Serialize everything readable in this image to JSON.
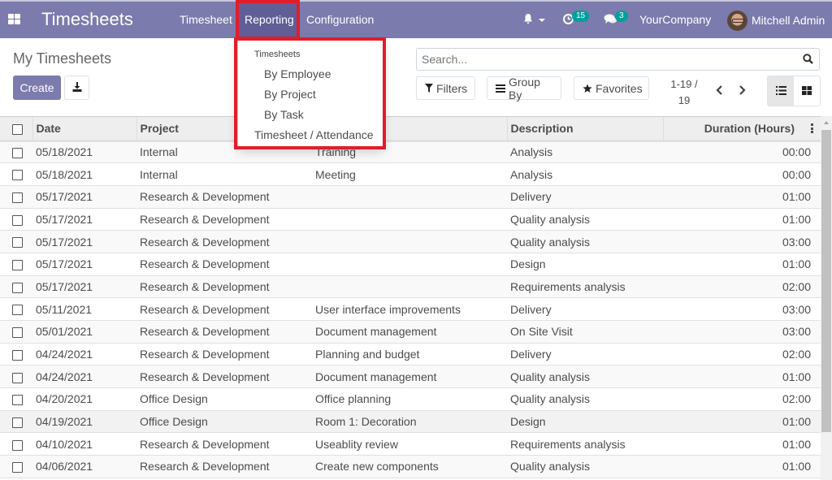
{
  "navbar": {
    "app_title": "Timesheets",
    "menu": [
      {
        "label": "Timesheet"
      },
      {
        "label": "Reporting",
        "active": true
      },
      {
        "label": "Configuration"
      }
    ],
    "activity_count": "15",
    "messages_count": "3",
    "company": "YourCompany",
    "user_name": "Mitchell Admin",
    "accent_color": "#7c7bad",
    "badge_color": "#00a09d"
  },
  "reporting_dropdown": {
    "header": "Timesheets",
    "items": [
      {
        "label": "By Employee"
      },
      {
        "label": "By Project"
      },
      {
        "label": "By Task"
      },
      {
        "label": "Timesheet / Attendance"
      }
    ],
    "highlight_color": "#e21d2a"
  },
  "control_panel": {
    "breadcrumb": "My Timesheets",
    "create_label": "Create",
    "search_placeholder": "Search...",
    "filters_label": "Filters",
    "groupby_label": "Group By",
    "favorites_label": "Favorites",
    "pager_line1": "1-19 /",
    "pager_line2": "19",
    "active_view": "list"
  },
  "table": {
    "headers": {
      "date": "Date",
      "project": "Project",
      "task": "",
      "description": "Description",
      "duration": "Duration (Hours)"
    },
    "rows": [
      {
        "date": "05/18/2021",
        "project": "Internal",
        "task": "Training",
        "description": "Analysis",
        "duration": "00:00"
      },
      {
        "date": "05/18/2021",
        "project": "Internal",
        "task": "Meeting",
        "description": "Analysis",
        "duration": "00:00"
      },
      {
        "date": "05/17/2021",
        "project": "Research & Development",
        "task": "",
        "description": "Delivery",
        "duration": "01:00"
      },
      {
        "date": "05/17/2021",
        "project": "Research & Development",
        "task": "",
        "description": "Quality analysis",
        "duration": "01:00"
      },
      {
        "date": "05/17/2021",
        "project": "Research & Development",
        "task": "",
        "description": "Quality analysis",
        "duration": "03:00"
      },
      {
        "date": "05/17/2021",
        "project": "Research & Development",
        "task": "",
        "description": "Design",
        "duration": "01:00"
      },
      {
        "date": "05/17/2021",
        "project": "Research & Development",
        "task": "",
        "description": "Requirements analysis",
        "duration": "02:00"
      },
      {
        "date": "05/11/2021",
        "project": "Research & Development",
        "task": "User interface improvements",
        "description": "Delivery",
        "duration": "03:00"
      },
      {
        "date": "05/01/2021",
        "project": "Research & Development",
        "task": "Document management",
        "description": "On Site Visit",
        "duration": "03:00"
      },
      {
        "date": "04/24/2021",
        "project": "Research & Development",
        "task": "Planning and budget",
        "description": "Delivery",
        "duration": "02:00"
      },
      {
        "date": "04/24/2021",
        "project": "Research & Development",
        "task": "Document management",
        "description": "Quality analysis",
        "duration": "01:00"
      },
      {
        "date": "04/20/2021",
        "project": "Office Design",
        "task": "Office planning",
        "description": "Quality analysis",
        "duration": "02:00"
      },
      {
        "date": "04/19/2021",
        "project": "Office Design",
        "task": "Room 1: Decoration",
        "description": "Design",
        "duration": "01:00"
      },
      {
        "date": "04/10/2021",
        "project": "Research & Development",
        "task": "Useablity review",
        "description": "Requirements analysis",
        "duration": "01:00"
      },
      {
        "date": "04/06/2021",
        "project": "Research & Development",
        "task": "Create new components",
        "description": "Quality analysis",
        "duration": "01:00"
      }
    ]
  }
}
